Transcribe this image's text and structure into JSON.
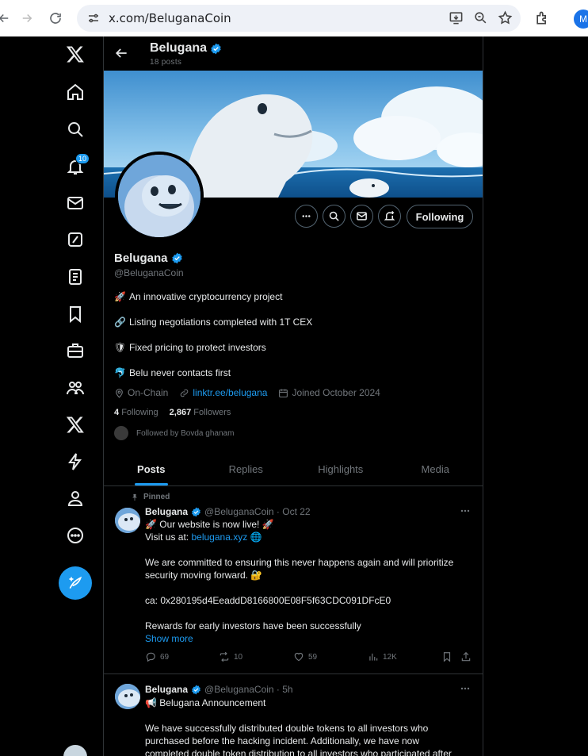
{
  "browser": {
    "url": "x.com/BeluganaCoin",
    "profile_initial": "M"
  },
  "nav": {
    "notification_count": "10",
    "items": [
      "x-logo",
      "home-icon",
      "explore-icon",
      "notifications-icon",
      "messages-icon",
      "grok-icon",
      "lists-icon",
      "bookmarks-icon",
      "jobs-icon",
      "communities-icon",
      "premium-icon",
      "verified-orgs-icon",
      "profile-icon",
      "more-icon"
    ]
  },
  "header": {
    "name": "Belugana",
    "posts_count": "18 posts"
  },
  "profile": {
    "name": "Belugana",
    "handle": "@BeluganaCoin",
    "following_label": "Following",
    "bio": [
      {
        "emoji": "🚀",
        "text": "An innovative cryptocurrency project"
      },
      {
        "emoji": "🔗",
        "text": "Listing negotiations completed with 1T CEX"
      },
      {
        "emoji": "🛡",
        "text": "Fixed pricing to protect investors"
      },
      {
        "emoji": "🐬",
        "text": "Belu never contacts first"
      }
    ],
    "location": "On-Chain",
    "website": "linktr.ee/belugana",
    "joined": "Joined October 2024",
    "following_count": "4",
    "following_text": "Following",
    "followers_count": "2,867",
    "followers_text": "Followers",
    "followed_by": "Followed by Bovda ghanam"
  },
  "tabs": [
    "Posts",
    "Replies",
    "Highlights",
    "Media"
  ],
  "tweets": [
    {
      "pinned": "Pinned",
      "name": "Belugana",
      "handle_time": "@BeluganaCoin · Oct 22",
      "lines": [
        "🚀 Our website is now live! 🚀",
        "Visit us at: ",
        "",
        "We are committed to ensuring this never happens again and will prioritize",
        "security moving forward. 🔐",
        "",
        "ca: 0x280195d4EeaddD8166800E08F5f63CDC091DFcE0",
        "",
        "Rewards for early investors have been successfully"
      ],
      "link": "belugana.xyz",
      "show_more": "Show more",
      "replies": "69",
      "reposts": "10",
      "likes": "59",
      "views": "12K"
    },
    {
      "name": "Belugana",
      "handle_time": "@BeluganaCoin · 5h",
      "lines": [
        "📢 Belugana Announcement",
        "",
        "We have successfully distributed double tokens to all investors who",
        "purchased before the hacking incident. Additionally, we have now",
        "completed double token distribution to all investors who participated after"
      ]
    }
  ],
  "colors": {
    "accent": "#1d9bf0",
    "background": "#000000",
    "muted": "#71767b"
  }
}
